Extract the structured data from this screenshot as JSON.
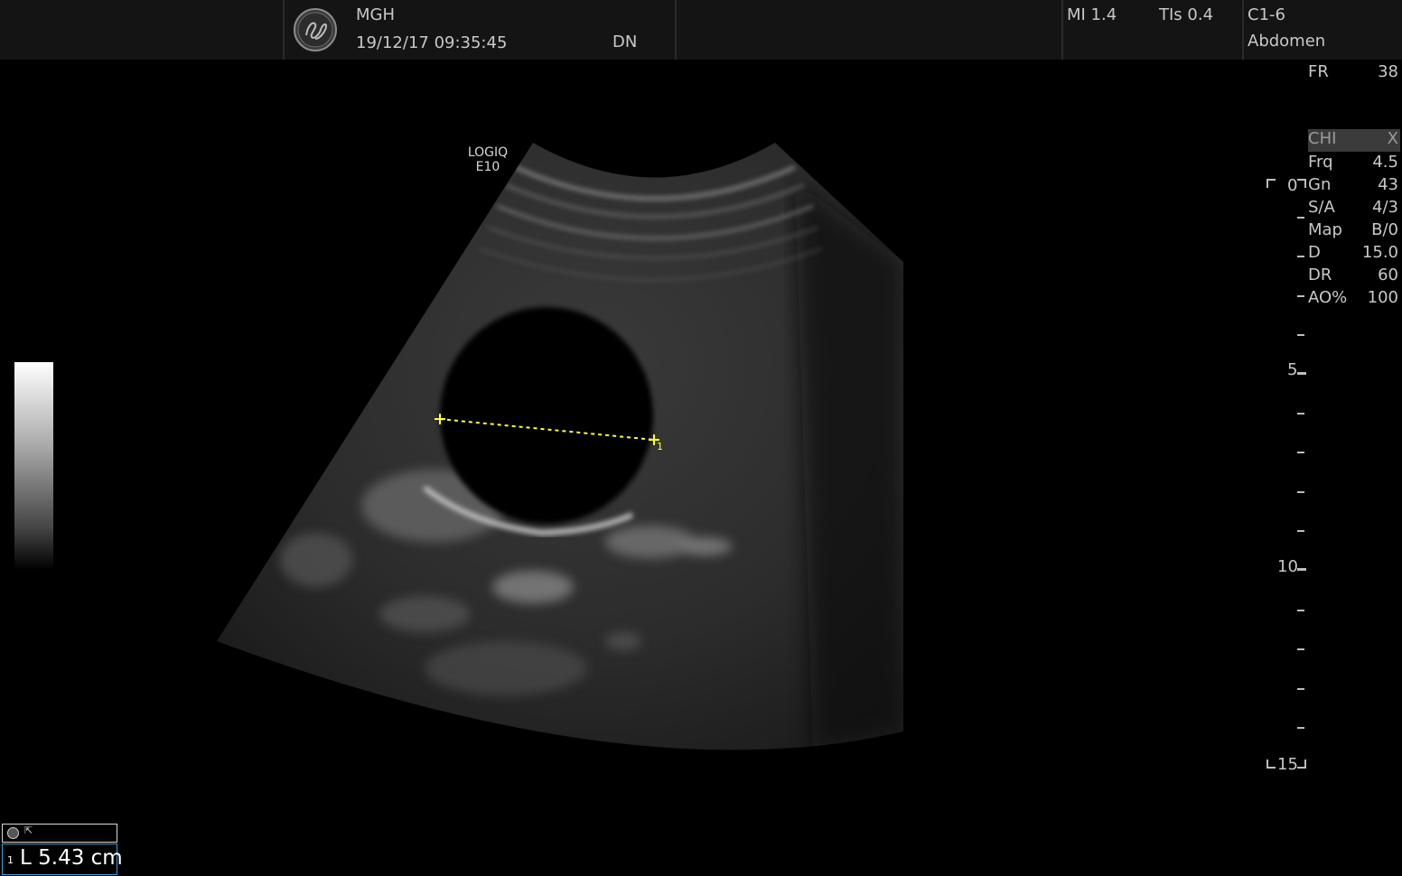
{
  "header": {
    "institution": "MGH",
    "datetime": "19/12/17 09:35:45",
    "operator": "DN",
    "mi": "MI 1.4",
    "tis": "TIs 0.4",
    "probe": "C1-6",
    "preset": "Abdomen"
  },
  "device": {
    "line1": "LOGIQ",
    "line2": "E10"
  },
  "params": {
    "fr": {
      "label": "FR",
      "value": "38"
    },
    "rows": [
      {
        "label": "CHI",
        "value": "X"
      },
      {
        "label": "Frq",
        "value": "4.5"
      },
      {
        "label": "Gn",
        "value": "43"
      },
      {
        "label": "S/A",
        "value": "4/3"
      },
      {
        "label": "Map",
        "value": "B/0"
      },
      {
        "label": "D",
        "value": "15.0"
      },
      {
        "label": "DR",
        "value": "60"
      },
      {
        "label": "AO%",
        "value": "100"
      }
    ]
  },
  "depth_scale": {
    "labels": [
      "0",
      "5",
      "10",
      "15"
    ]
  },
  "measurement": {
    "index": "1",
    "text": "L  5.43 cm",
    "caliper_label": "1",
    "caliper_color": "#ffff33"
  },
  "icons": {
    "logo": "ge-logo-icon",
    "cursor": "cursor-icon"
  }
}
